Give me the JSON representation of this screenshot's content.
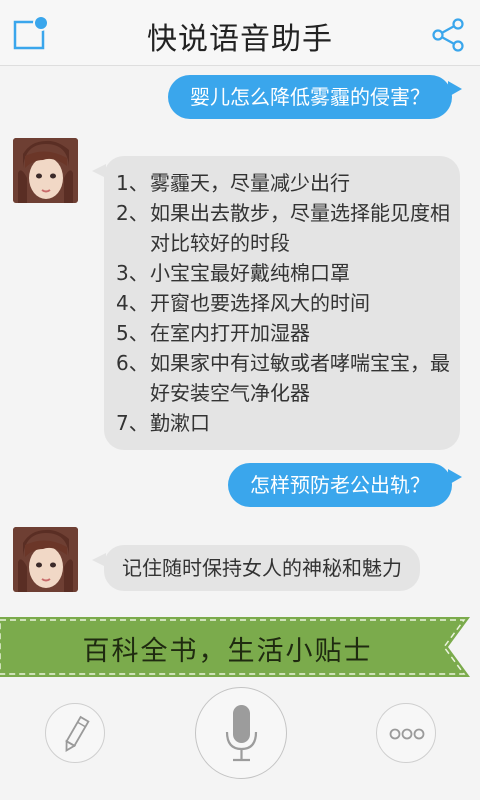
{
  "header": {
    "title": "快说语音助手",
    "compose_icon": "compose-icon",
    "share_icon": "share-icon",
    "accent_color": "#3aa6ec"
  },
  "conversation": {
    "q1": "婴儿怎么降低雾霾的侵害？",
    "a1": [
      {
        "num": "1、",
        "text": "雾霾天，尽量减少出行"
      },
      {
        "num": "2、",
        "text": "如果出去散步，尽量选择能见度相对比较好的时段"
      },
      {
        "num": "3、",
        "text": "小宝宝最好戴纯棉口罩"
      },
      {
        "num": "4、",
        "text": "开窗也要选择风大的时间"
      },
      {
        "num": "5、",
        "text": "在室内打开加湿器"
      },
      {
        "num": "6、",
        "text": "如果家中有过敏或者哮喘宝宝，最好安装空气净化器"
      },
      {
        "num": "7、",
        "text": "勤漱口"
      }
    ],
    "q2": "怎样预防老公出轨？",
    "a2": "记住随时保持女人的神秘和魅力"
  },
  "banner": {
    "text": "百科全书，生活小贴士",
    "color": "#7bab4c"
  },
  "bottom_bar": {
    "edit_icon": "pencil-icon",
    "mic_icon": "microphone-icon",
    "more_icon": "ellipsis-icon"
  }
}
